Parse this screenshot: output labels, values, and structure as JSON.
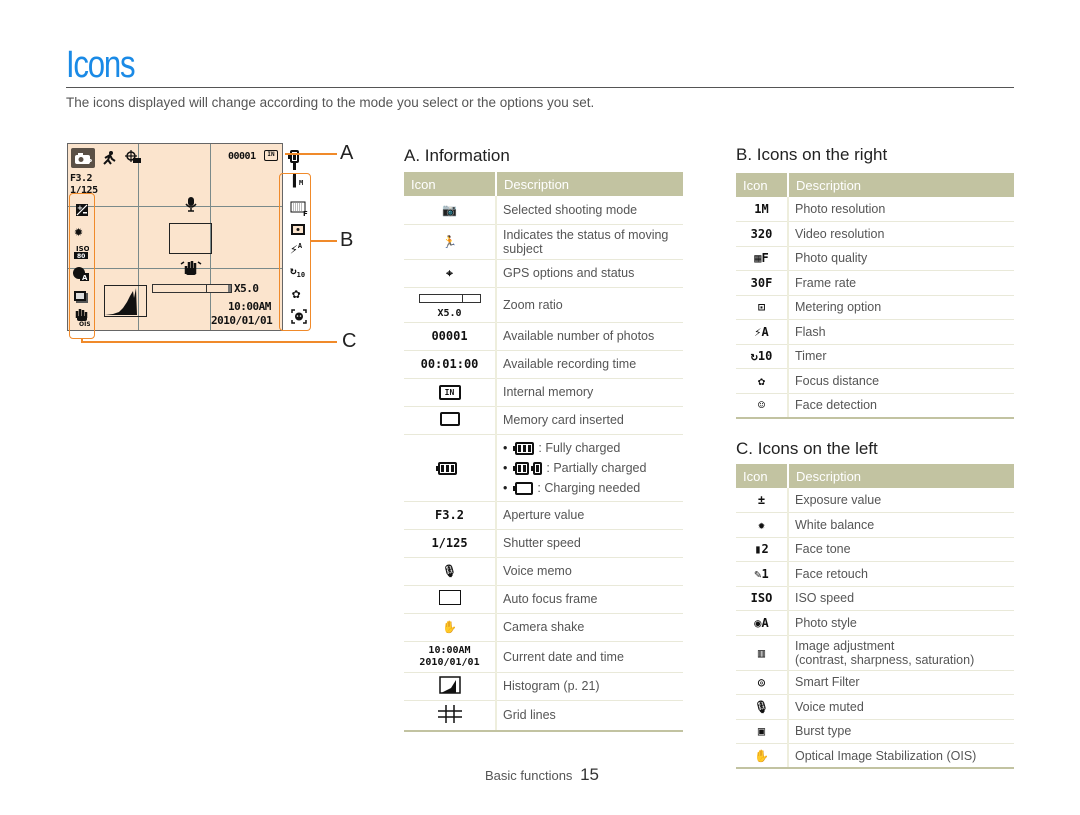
{
  "page": {
    "title": "Icons",
    "intro": "The icons displayed will change according to the mode you select or the options you set."
  },
  "camera_screen": {
    "callouts": [
      "A",
      "B",
      "C"
    ],
    "aperture": "F3.2",
    "shutter": "1/125",
    "photo_count": "00001",
    "zoom": "X5.0",
    "time": "10:00AM",
    "date": "2010/01/01",
    "memory": "IN",
    "resolution": "1M",
    "flash": "A",
    "timer": "10",
    "iso_top": "ISO",
    "iso_bottom": "80",
    "ois": "OIS",
    "colors": {
      "screen_bg": "#fbe4cd",
      "callout_line": "#f08a2a"
    }
  },
  "headers": {
    "icon": "Icon",
    "description": "Description"
  },
  "section_a": {
    "title": "A. Information",
    "rows": [
      {
        "icon": "camera-program-icon",
        "glyph": "📷",
        "desc": "Selected shooting mode"
      },
      {
        "icon": "moving-subject-icon",
        "glyph": "🏃",
        "desc": "Indicates the status of moving subject"
      },
      {
        "icon": "gps-icon",
        "glyph": "⌖",
        "desc": "GPS options and status"
      },
      {
        "icon": "zoom-ratio-icon",
        "glyph": "X5.0",
        "desc": "Zoom ratio"
      },
      {
        "icon": "photo-count-icon",
        "glyph": "00001",
        "desc": "Available number of photos"
      },
      {
        "icon": "recording-time-icon",
        "glyph": "00:01:00",
        "desc": "Available recording time"
      },
      {
        "icon": "internal-memory-icon",
        "glyph": "IN",
        "desc": "Internal memory"
      },
      {
        "icon": "memory-card-icon",
        "glyph": "",
        "desc": "Memory card inserted"
      },
      {
        "icon": "battery-icon",
        "glyph": "",
        "desc": "",
        "battery_states": [
          {
            "label": ": Fully charged"
          },
          {
            "label": ": Partially charged"
          },
          {
            "label": ": Charging needed"
          }
        ]
      },
      {
        "icon": "aperture-icon",
        "glyph": "F3.2",
        "desc": "Aperture value"
      },
      {
        "icon": "shutter-speed-icon",
        "glyph": "1/125",
        "desc": "Shutter speed"
      },
      {
        "icon": "microphone-icon",
        "glyph": "🎙",
        "desc": "Voice memo"
      },
      {
        "icon": "af-frame-icon",
        "glyph": "",
        "desc": "Auto focus frame"
      },
      {
        "icon": "camera-shake-icon",
        "glyph": "✋",
        "desc": "Camera shake"
      },
      {
        "icon": "date-time-icon",
        "glyph": "10:00AM",
        "glyph2": "2010/01/01",
        "desc": "Current date and time"
      },
      {
        "icon": "histogram-icon",
        "glyph": "",
        "desc": "Histogram (p. 21)"
      },
      {
        "icon": "grid-lines-icon",
        "glyph": "#",
        "desc": "Grid lines"
      }
    ]
  },
  "section_b": {
    "title": "B. Icons on the right",
    "rows": [
      {
        "icon": "photo-resolution-icon",
        "glyph": "1M",
        "desc": "Photo resolution"
      },
      {
        "icon": "video-resolution-icon",
        "glyph": "320",
        "desc": "Video resolution"
      },
      {
        "icon": "photo-quality-icon",
        "glyph": "▦F",
        "desc": "Photo quality"
      },
      {
        "icon": "frame-rate-icon",
        "glyph": "30F",
        "desc": "Frame rate"
      },
      {
        "icon": "metering-icon",
        "glyph": "⊡",
        "desc": "Metering option"
      },
      {
        "icon": "flash-icon",
        "glyph": "⚡A",
        "desc": "Flash"
      },
      {
        "icon": "timer-icon",
        "glyph": "↻10",
        "desc": "Timer"
      },
      {
        "icon": "focus-distance-icon",
        "glyph": "✿",
        "desc": "Focus distance"
      },
      {
        "icon": "face-detection-icon",
        "glyph": "☺",
        "desc": "Face detection"
      }
    ]
  },
  "section_c": {
    "title": "C. Icons on the left",
    "rows": [
      {
        "icon": "exposure-value-icon",
        "glyph": "±",
        "desc": "Exposure value"
      },
      {
        "icon": "white-balance-icon",
        "glyph": "✹",
        "desc": "White balance"
      },
      {
        "icon": "face-tone-icon",
        "glyph": "▮2",
        "desc": "Face tone"
      },
      {
        "icon": "face-retouch-icon",
        "glyph": "✎1",
        "desc": "Face retouch"
      },
      {
        "icon": "iso-speed-icon",
        "glyph": "ISO",
        "desc": "ISO speed"
      },
      {
        "icon": "photo-style-icon",
        "glyph": "◉A",
        "desc": "Photo style"
      },
      {
        "icon": "image-adjustment-icon",
        "glyph": "▥",
        "desc": "Image adjustment",
        "desc2": "(contrast, sharpness, saturation)"
      },
      {
        "icon": "smart-filter-icon",
        "glyph": "◎",
        "desc": "Smart Filter"
      },
      {
        "icon": "voice-muted-icon",
        "glyph": "🎙",
        "desc": "Voice muted"
      },
      {
        "icon": "burst-type-icon",
        "glyph": "▣",
        "desc": "Burst type"
      },
      {
        "icon": "ois-icon",
        "glyph": "✋",
        "desc": "Optical Image Stabilization (OIS)"
      }
    ]
  },
  "footer": {
    "section": "Basic functions",
    "page_number": "15"
  }
}
